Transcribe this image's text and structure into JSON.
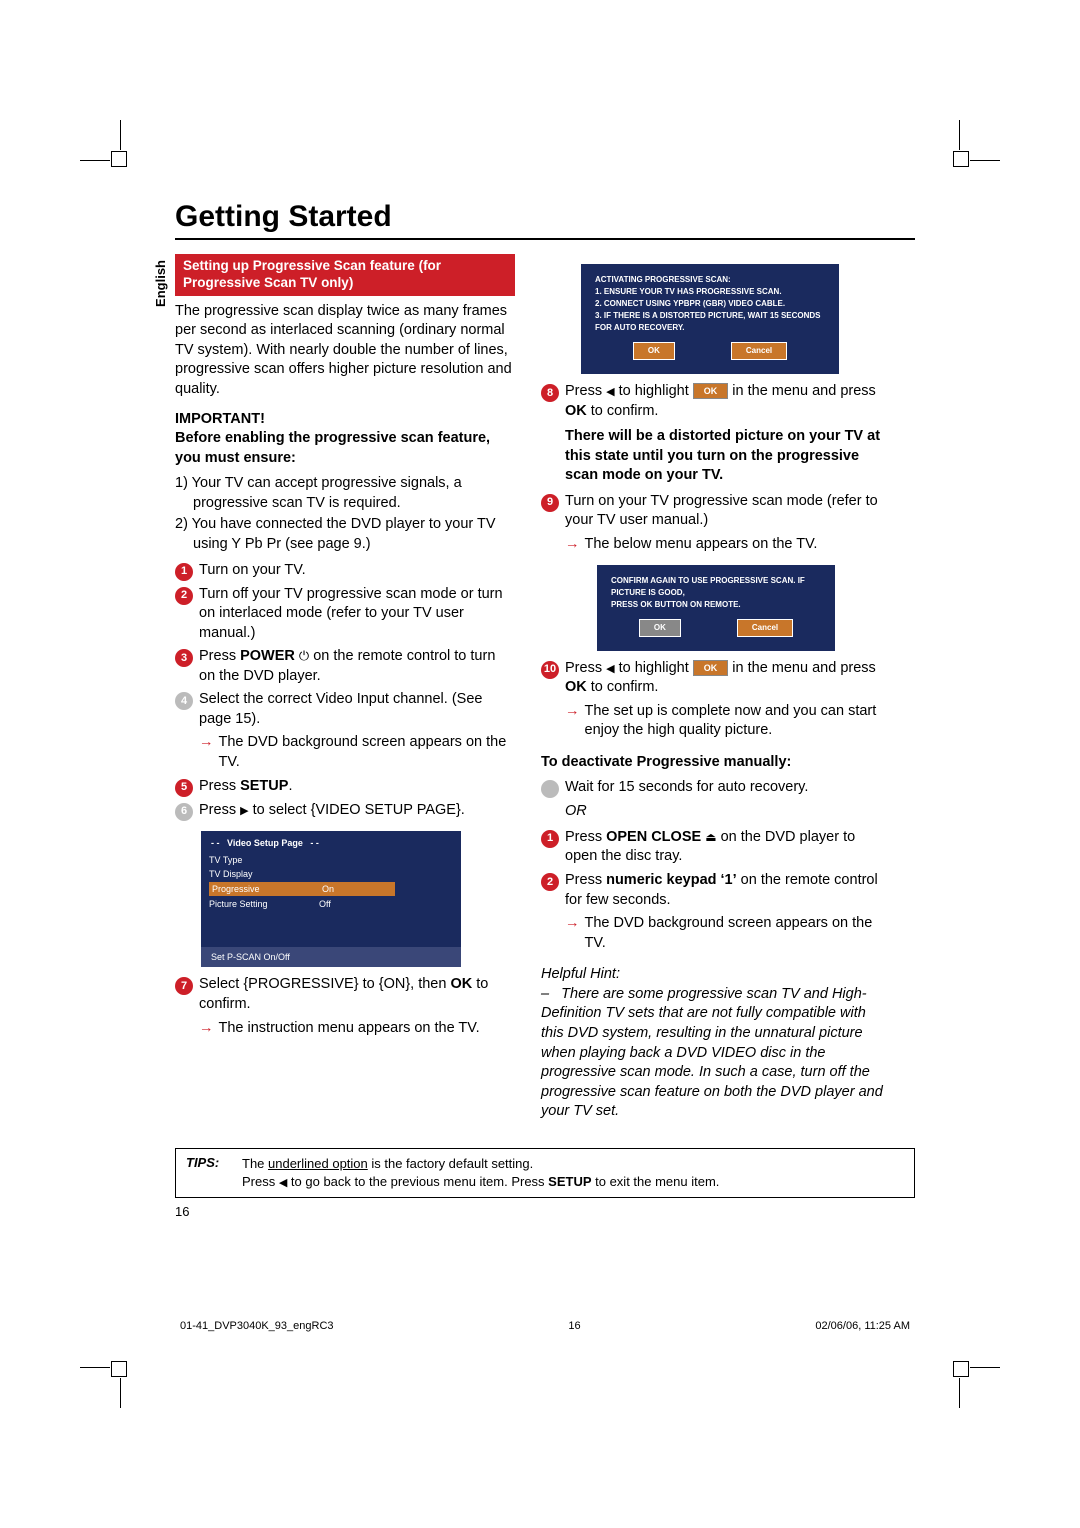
{
  "language_tab": "English",
  "title": "Getting Started",
  "section_header": "Setting up Progressive Scan feature (for Progressive Scan TV only)",
  "intro": "The progressive scan display twice as many frames per second as interlaced scanning (ordinary normal TV system). With nearly double the number of lines, progressive scan offers higher picture resolution and quality.",
  "important_label": "IMPORTANT!",
  "important_sub": "Before enabling the progressive scan feature, you must ensure:",
  "ensure": [
    "1) Your TV can accept progressive signals, a progressive scan TV is required.",
    "2) You have connected the DVD player to your TV using Y Pb Pr (see page 9.)"
  ],
  "steps_left": [
    {
      "n": "1",
      "t": "Turn on your TV."
    },
    {
      "n": "2",
      "t": "Turn off your TV progressive scan mode or turn on interlaced mode (refer to your TV user manual.)"
    },
    {
      "n": "3",
      "t": "Press ",
      "after": " on the remote control to turn on the DVD player.",
      "bold": "POWER",
      "icon": "power"
    },
    {
      "n": "4",
      "t": "Select the correct Video Input channel. (See page 15).",
      "res": "The DVD background screen appears on the TV."
    },
    {
      "n": "5",
      "t": "Press ",
      "bold": "SETUP",
      "after": "."
    },
    {
      "n": "6",
      "t": "Press ",
      "icon": "right",
      "after": " to select {VIDEO SETUP PAGE}."
    }
  ],
  "osd1": {
    "title": "- -   Video Setup Page   - -",
    "rows": [
      {
        "l": "TV Type",
        "r": ""
      },
      {
        "l": "TV Display",
        "r": ""
      },
      {
        "l": "Progressive",
        "r": "On",
        "hl": true
      },
      {
        "l": "Picture Setting",
        "r": "Off"
      }
    ],
    "foot": "Set P-SCAN On/Off"
  },
  "step7": {
    "n": "7",
    "t": "Select {PROGRESSIVE} to {ON}, then ",
    "bold": "OK",
    "after": " to confirm.",
    "res": "The instruction menu appears on the TV."
  },
  "osd2": {
    "lines": [
      "ACTIVATING PROGRESSIVE SCAN:",
      "1. ENSURE YOUR TV HAS PROGRESSIVE SCAN.",
      "2. CONNECT USING YPBPR (GBR) VIDEO CABLE.",
      "3. IF THERE IS A DISTORTED PICTURE, WAIT 15 SECONDS FOR AUTO RECOVERY."
    ],
    "ok": "OK",
    "cancel": "Cancel"
  },
  "step8": {
    "n": "8",
    "pre": "Press ",
    "mid": " to highlight ",
    "post": " in the menu and press ",
    "bold": "OK",
    "after": " to confirm.",
    "chip": "OK"
  },
  "warning": "There will be a distorted picture on your TV at this state until you turn on the progressive scan mode on your TV.",
  "step9": {
    "n": "9",
    "t": "Turn on your TV progressive scan mode (refer to your TV user manual.)",
    "res": "The below menu appears on the TV."
  },
  "osd3": {
    "lines": [
      "CONFIRM AGAIN TO USE PROGRESSIVE SCAN. IF PICTURE IS GOOD,",
      "PRESS OK BUTTON ON REMOTE."
    ],
    "ok": "OK",
    "cancel": "Cancel"
  },
  "step10": {
    "n": "10",
    "pre": "Press ",
    "mid": " to highlight ",
    "post": " in the menu and press ",
    "bold": "OK",
    "after": " to confirm.",
    "chip": "OK",
    "res": "The set up is complete now and you can start enjoy the high quality picture."
  },
  "deact_h": "To deactivate Progressive manually:",
  "deact_wait": "Wait for 15 seconds for auto recovery.",
  "or": "OR",
  "deact_steps": [
    {
      "n": "1",
      "pre": "Press ",
      "bold": "OPEN CLOSE",
      "icon": "eject",
      "after": " on the DVD player to open the disc tray."
    },
    {
      "n": "2",
      "pre": "Press ",
      "bold": "numeric keypad ‘1’",
      "after": " on the remote control for few seconds.",
      "res": "The DVD background screen appears on the TV."
    }
  ],
  "hint_label": "Helpful Hint:",
  "hint_body": "–   There are some progressive scan TV and High-Definition TV sets that are not fully compatible with this DVD system, resulting in the unnatural picture when playing back a DVD VIDEO disc in the progressive scan mode.  In such a case, turn off the progressive scan feature on both the DVD player and your TV set.",
  "tips_label": "TIPS:",
  "tips_l1_a": "The ",
  "tips_l1_u": "underlined option",
  "tips_l1_b": " is the factory default setting.",
  "tips_l2_a": "Press ",
  "tips_l2_b": " to go back to the previous menu item. Press ",
  "tips_l2_bold": "SETUP",
  "tips_l2_c": " to exit the menu item.",
  "page_number": "16",
  "footer": {
    "file": "01-41_DVP3040K_93_engRC3",
    "pg": "16",
    "dt": "02/06/06, 11:25 AM"
  }
}
